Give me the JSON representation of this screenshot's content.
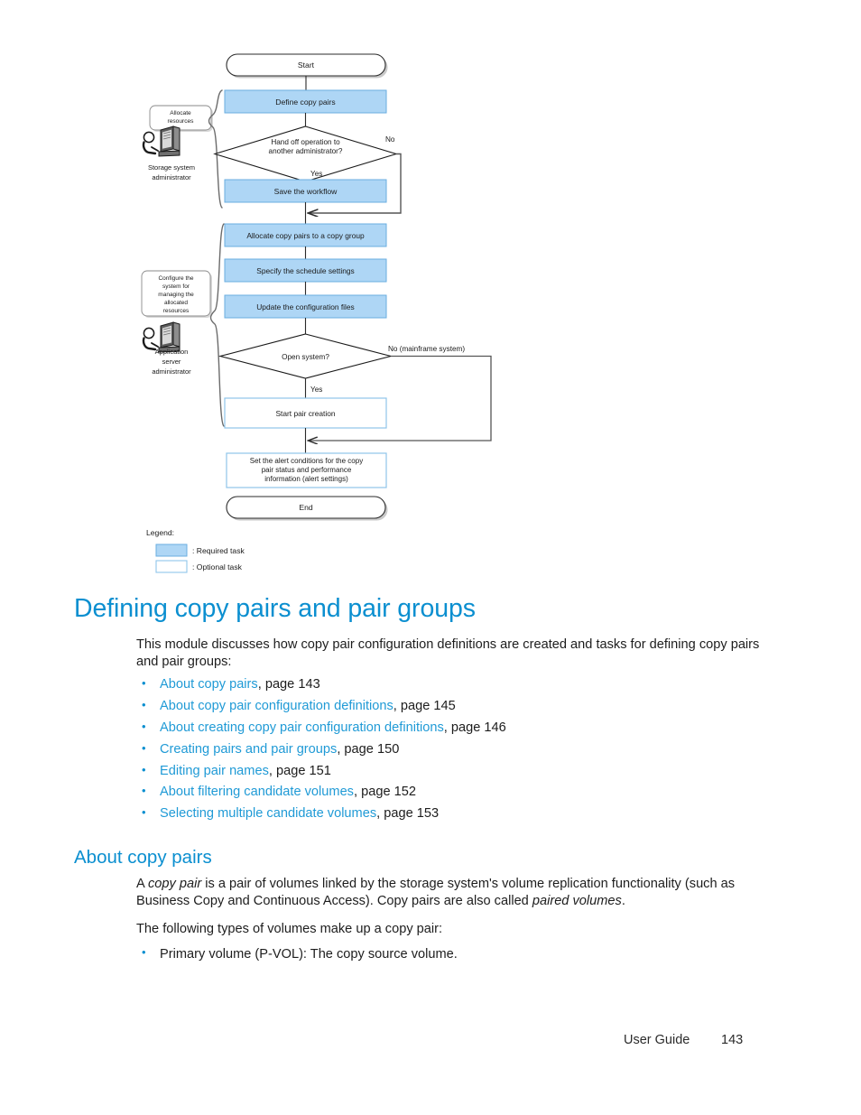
{
  "flowchart": {
    "start_label": "Start",
    "end_label": "End",
    "roles": [
      {
        "bubble": "Allocate\nresources",
        "name_line1": "Storage system",
        "name_line2": "administrator"
      },
      {
        "bubble": "Configure the\nsystem for\nmanaging the\nallocated\nresources",
        "name_line1": "Application",
        "name_line2": "server",
        "name_line3": "administrator"
      }
    ],
    "steps": [
      {
        "id": "define-copy-pairs",
        "label": "Define copy pairs",
        "kind": "required"
      },
      {
        "id": "save-the-workflow",
        "label": "Save the workflow",
        "kind": "required"
      },
      {
        "id": "allocate-copy-pairs",
        "label": "Allocate copy pairs to a copy group",
        "kind": "required"
      },
      {
        "id": "specify-schedule-settings",
        "label": "Specify the schedule settings",
        "kind": "required"
      },
      {
        "id": "update-configuration-files",
        "label": "Update the configuration files",
        "kind": "required"
      },
      {
        "id": "start-pair-creation",
        "label": "Start pair creation",
        "kind": "optional"
      },
      {
        "id": "set-alert-conditions",
        "label": "Set the alert conditions for the copy\npair status and performance\ninformation (alert settings)",
        "kind": "optional"
      }
    ],
    "decisions": [
      {
        "id": "hand-off-operation",
        "line1": "Hand off operation to",
        "line2": "another administrator?",
        "yes_label": "Yes",
        "no_label": "No"
      },
      {
        "id": "open-system",
        "line1": "Open system?",
        "line2": "",
        "yes_label": "Yes",
        "no_label": "No (mainframe system)"
      }
    ],
    "legend": {
      "title": "Legend:",
      "required": ": Required task",
      "optional": ": Optional task"
    },
    "colors": {
      "required_fill": "#aed6f5",
      "required_stroke": "#6aaee0",
      "optional_fill": "#ffffff",
      "optional_stroke": "#8fc5ea",
      "line": "#2b2b2b",
      "shadow": "#c9c9c9"
    }
  },
  "page": {
    "title": "Defining copy pairs and pair groups",
    "intro": "This module discusses how copy pair configuration definitions are created and tasks for defining copy pairs and pair groups:",
    "links": [
      {
        "text": "About copy pairs",
        "page": ", page 143"
      },
      {
        "text": "About copy pair configuration definitions",
        "page": ", page 145"
      },
      {
        "text": "About creating copy pair configuration definitions",
        "page": ", page 146"
      },
      {
        "text": "Creating pairs and pair groups",
        "page": ", page 150"
      },
      {
        "text": "Editing pair names",
        "page": ", page 151"
      },
      {
        "text": "About filtering candidate volumes",
        "page": ", page 152"
      },
      {
        "text": "Selecting multiple candidate volumes",
        "page": ", page 153"
      }
    ],
    "section": {
      "title": "About copy pairs",
      "para1_a": "A ",
      "para1_em1": "copy pair",
      "para1_b": " is a pair of volumes linked by the storage system's volume replication functionality (such as Business Copy and Continuous Access). Copy pairs are also called ",
      "para1_em2": "paired volumes",
      "para1_c": ".",
      "para2": "The following types of volumes make up a copy pair:",
      "bullet1": "Primary volume (P-VOL): The copy source volume."
    }
  },
  "footer": {
    "label": "User Guide",
    "page_number": "143"
  }
}
